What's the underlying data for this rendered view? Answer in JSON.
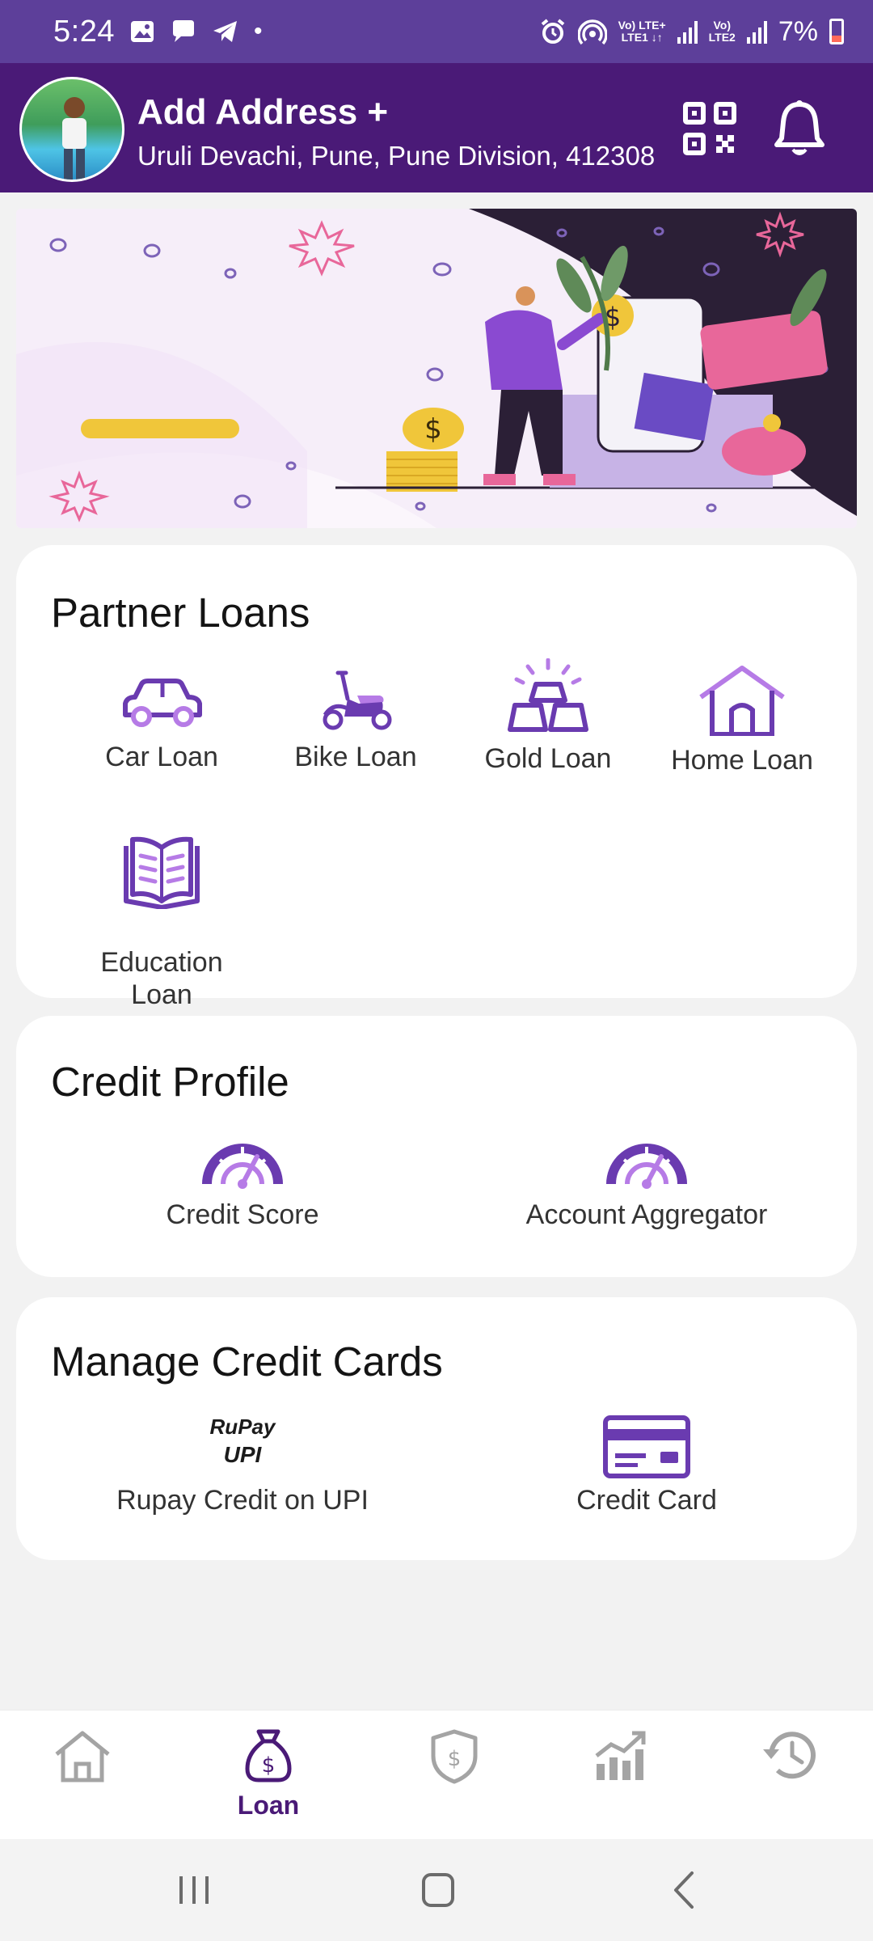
{
  "status_bar": {
    "time": "5:24",
    "battery": "7%",
    "sim1": "Vo)) LTE+\nLTE1",
    "sim2": "Vo))\nLTE2"
  },
  "header": {
    "title": "Add Address +",
    "subtitle": "Uruli Devachi, Pune, Pune Division, 412308"
  },
  "partner_loans": {
    "title": "Partner Loans",
    "items": [
      {
        "label": "Car Loan",
        "icon": "car-icon"
      },
      {
        "label": "Bike Loan",
        "icon": "scooter-icon"
      },
      {
        "label": "Gold Loan",
        "icon": "gold-bars-icon"
      },
      {
        "label": "Home Loan",
        "icon": "home-icon"
      },
      {
        "label": "Education\nLoan",
        "icon": "book-icon"
      }
    ]
  },
  "credit_profile": {
    "title": "Credit Profile",
    "items": [
      {
        "label": "Credit Score",
        "icon": "gauge-icon"
      },
      {
        "label": "Account Aggregator",
        "icon": "gauge-icon"
      }
    ]
  },
  "manage_cards": {
    "title": "Manage Credit Cards",
    "items": [
      {
        "label": "Rupay Credit on UPI",
        "icon": "rupay-upi-logo"
      },
      {
        "label": "Credit Card",
        "icon": "credit-card-icon"
      }
    ],
    "rupay_logo_text": "RuPay",
    "upi_logo_text": "UPI"
  },
  "bottom_nav": {
    "items": [
      {
        "name": "home",
        "label": ""
      },
      {
        "name": "loan",
        "label": "Loan",
        "active": true
      },
      {
        "name": "insurance",
        "label": ""
      },
      {
        "name": "wealth",
        "label": ""
      },
      {
        "name": "history",
        "label": ""
      }
    ]
  },
  "colors": {
    "brand": "#4a1a77",
    "accent": "#6a3bb0",
    "light_accent": "#b67be6"
  }
}
